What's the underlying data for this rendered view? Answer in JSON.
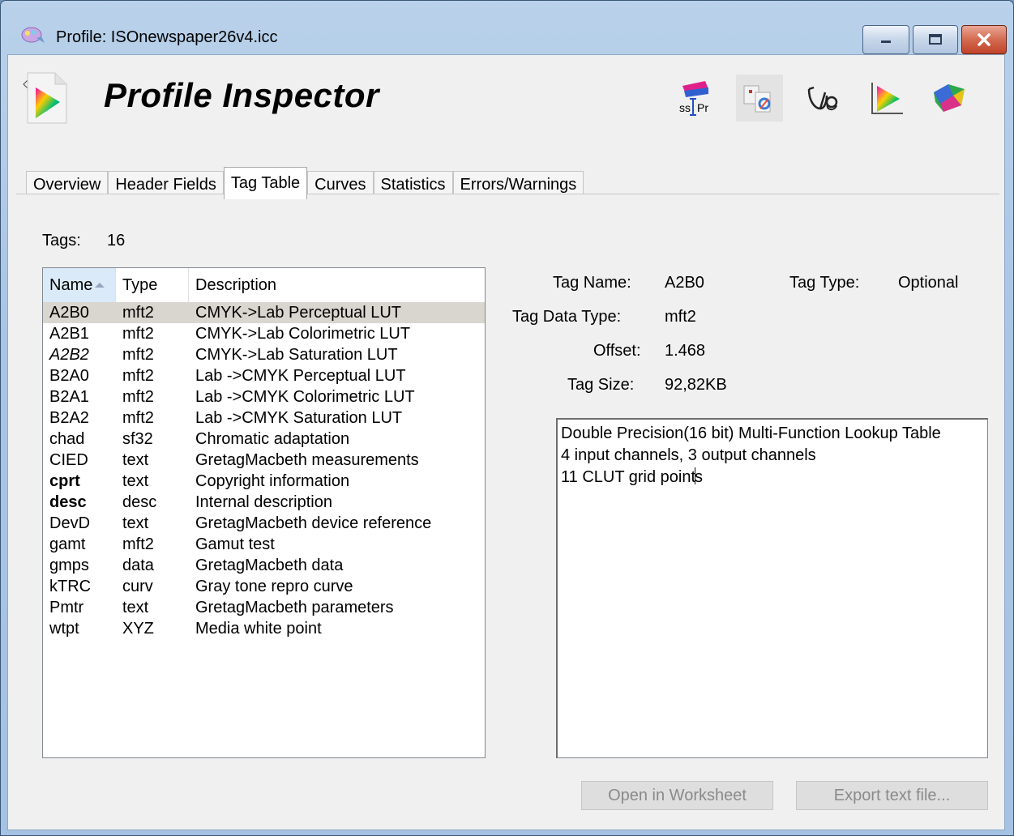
{
  "window": {
    "title": "Profile: ISOnewspaper26v4.icc"
  },
  "app": {
    "name": "Profile Inspector"
  },
  "toolbar": {
    "icons": [
      "profile-maker-icon",
      "profile-editor-icon",
      "measure-tool-icon",
      "gamut-viewer-icon",
      "gamut-3d-icon"
    ]
  },
  "tabs": [
    {
      "label": "Overview"
    },
    {
      "label": "Header Fields"
    },
    {
      "label": "Tag Table",
      "active": true
    },
    {
      "label": "Curves"
    },
    {
      "label": "Statistics"
    },
    {
      "label": "Errors/Warnings"
    }
  ],
  "tags": {
    "label": "Tags:",
    "count": "16"
  },
  "table": {
    "columns": [
      "Name",
      "Type",
      "Description"
    ],
    "rows": [
      {
        "name": "A2B0",
        "type": "mft2",
        "desc": "CMYK->Lab  Perceptual LUT"
      },
      {
        "name": "A2B1",
        "type": "mft2",
        "desc": "CMYK->Lab  Colorimetric LUT"
      },
      {
        "name": "A2B2",
        "type": "mft2",
        "desc": "CMYK->Lab  Saturation LUT"
      },
      {
        "name": "B2A0",
        "type": "mft2",
        "desc": "Lab ->CMYK Perceptual LUT"
      },
      {
        "name": "B2A1",
        "type": "mft2",
        "desc": "Lab ->CMYK Colorimetric LUT"
      },
      {
        "name": "B2A2",
        "type": "mft2",
        "desc": "Lab ->CMYK Saturation LUT"
      },
      {
        "name": "chad",
        "type": "sf32",
        "desc": "Chromatic adaptation"
      },
      {
        "name": "CIED",
        "type": "text",
        "desc": "GretagMacbeth measurements"
      },
      {
        "name": "cprt",
        "type": "text",
        "desc": "Copyright information"
      },
      {
        "name": "desc",
        "type": "desc",
        "desc": "Internal description"
      },
      {
        "name": "DevD",
        "type": "text",
        "desc": "GretagMacbeth device reference"
      },
      {
        "name": "gamt",
        "type": "mft2",
        "desc": "Gamut test"
      },
      {
        "name": "gmps",
        "type": "data",
        "desc": "GretagMacbeth data"
      },
      {
        "name": "kTRC",
        "type": "curv",
        "desc": "Gray tone repro curve"
      },
      {
        "name": "Pmtr",
        "type": "text",
        "desc": "GretagMacbeth parameters"
      },
      {
        "name": "wtpt",
        "type": "XYZ",
        "desc": "Media white point"
      }
    ]
  },
  "details": {
    "tag_name_label": "Tag Name:",
    "tag_name": "A2B0",
    "tag_type_label": "Tag Type:",
    "tag_type": "Optional",
    "data_type_label": "Tag Data Type:",
    "data_type": "mft2",
    "offset_label": "Offset:",
    "offset": "1.468",
    "size_label": "Tag Size:",
    "size": "92,82KB",
    "text_line1": "Double Precision(16 bit) Multi-Function Lookup Table",
    "text_line2": "4 input channels, 3 output channels",
    "text_line3a": "11 CLUT grid point",
    "text_line3b": "s"
  },
  "buttons": {
    "open_worksheet": "Open in Worksheet",
    "export_text": "Export text file..."
  }
}
